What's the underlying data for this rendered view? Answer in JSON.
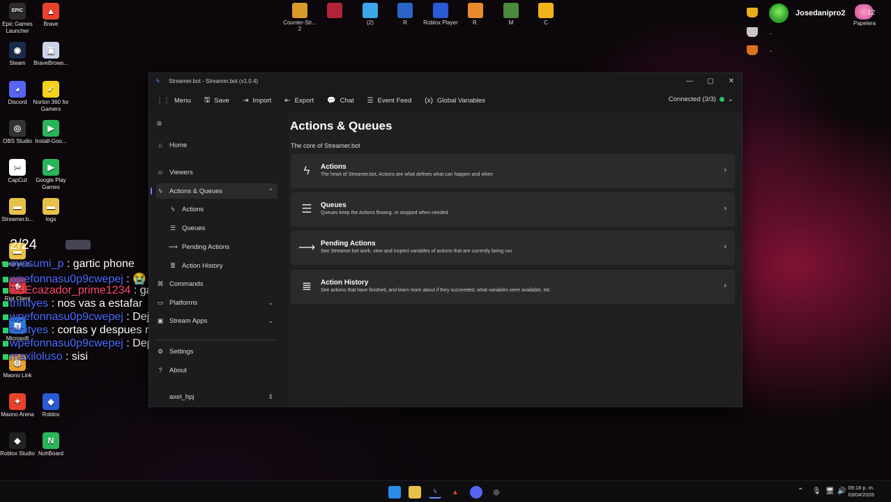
{
  "desktop": {
    "icons": [
      {
        "label": "Epic Games Launcher",
        "color": "#2b2b2b",
        "glyph": "EPIC"
      },
      {
        "label": "Brave",
        "color": "#e8412c",
        "glyph": "▲"
      },
      {
        "label": "Steam",
        "color": "#1a2a4a",
        "glyph": "◉"
      },
      {
        "label": "BraveBrows...",
        "color": "#c9d4e8",
        "glyph": "▣"
      },
      {
        "label": "Discord",
        "color": "#5865f2",
        "glyph": "◕"
      },
      {
        "label": "Norton 360 for Gamers",
        "color": "#f2d21a",
        "glyph": "✓"
      },
      {
        "label": "OBS Studio",
        "color": "#333",
        "glyph": "◎"
      },
      {
        "label": "Install-Goo...",
        "color": "#2ab55a",
        "glyph": "▶"
      },
      {
        "label": "CapCut",
        "color": "#fff",
        "glyph": "✂"
      },
      {
        "label": "Google Play Games",
        "color": "#2ab55a",
        "glyph": "▶"
      },
      {
        "label": "Streamer.b...",
        "color": "#e8c14a",
        "glyph": "▬"
      },
      {
        "label": "logs",
        "color": "#e8c14a",
        "glyph": "▬"
      },
      {
        "label": "Streamer.b...",
        "color": "#e8c14a",
        "glyph": "▬"
      },
      {
        "label": "Riot Client",
        "color": "#d13639",
        "glyph": "◆"
      },
      {
        "label": "Microsoft",
        "color": "#2a7ad6",
        "glyph": "▦"
      },
      {
        "label": "Maono Link",
        "color": "#e8a02c",
        "glyph": "◍"
      },
      {
        "label": "Maono Arena",
        "color": "#e8412c",
        "glyph": "✦"
      },
      {
        "label": "Roblox",
        "color": "#2a5ad6",
        "glyph": "◆"
      },
      {
        "label": "Roblox Studio",
        "color": "#222",
        "glyph": "◆"
      },
      {
        "label": "NohBoard",
        "color": "#2ab55a",
        "glyph": "N"
      }
    ],
    "top_icons": [
      {
        "label": "Counter-Str... 2",
        "color": "#d89a2a"
      },
      {
        "label": "",
        "color": "#b0243a"
      },
      {
        "label": "(2)",
        "color": "#3aa8e8"
      },
      {
        "label": "R",
        "color": "#2a64c8"
      },
      {
        "label": "Roblox Player",
        "color": "#2a5ad6"
      },
      {
        "label": "R.",
        "color": "#e88a2a"
      },
      {
        "label": "M",
        "color": "#4a8a3a"
      },
      {
        "label": "C",
        "color": "#f2b21a"
      }
    ],
    "user": {
      "name": "Josedanipro2",
      "count": "12",
      "bin_label": "Papelera",
      "dash1": "-",
      "dash2": "-"
    }
  },
  "chat": {
    "counter": "2/24",
    "lines": [
      {
        "user": "oyasumi_p",
        "msg": " : gartic phone",
        "red": false
      },
      {
        "user": "wpefonnasu0p9cwepej",
        "msg": " : 😭",
        "red": false
      },
      {
        "user": "THEcazador_prime1234",
        "msg": " : gallet te la pone",
        "red": true
      },
      {
        "user": "trinityes",
        "msg": " : nos vas a estafar",
        "red": false
      },
      {
        "user": "wpefonnasu0p9cwepej",
        "msg": " : Deja eso wue",
        "red": false
      },
      {
        "user": "trinityes",
        "msg": " : cortas y despues no prendes mas",
        "red": false
      },
      {
        "user": "wpefonnasu0p9cwepej",
        "msg": " : Deporsl nunca lo canjean",
        "red": false
      },
      {
        "user": "maxiloluso",
        "msg": " : sisi",
        "red": false
      }
    ]
  },
  "window": {
    "title": "Streamer.bot - Streamer.bot (v1.0.4)",
    "toolbar": [
      {
        "label": "Menu",
        "icon": "⋮⋮"
      },
      {
        "label": "Save",
        "icon": "🖫"
      },
      {
        "label": "Import",
        "icon": "⇥"
      },
      {
        "label": "Export",
        "icon": "⇤"
      },
      {
        "label": "Chat",
        "icon": "💬"
      },
      {
        "label": "Event Feed",
        "icon": "☰"
      },
      {
        "label": "Global Variables",
        "icon": "(x)"
      }
    ],
    "connection": "Connected (3/3)",
    "sidebar": {
      "home": "Home",
      "viewers": "Viewers",
      "actions_queues": "Actions & Queues",
      "actions": "Actions",
      "queues": "Queues",
      "pending_actions": "Pending Actions",
      "action_history": "Action History",
      "commands": "Commands",
      "platforms": "Platforms",
      "stream_apps": "Stream Apps",
      "settings": "Settings",
      "about": "About",
      "profile": "axel_hpj"
    },
    "content": {
      "title": "Actions & Queues",
      "subtitle": "The core of Streamer.bot",
      "cards": [
        {
          "title": "Actions",
          "desc": "The heart of Streamer.bot, Actions are what defines what can happen and when",
          "icon": "ϟ"
        },
        {
          "title": "Queues",
          "desc": "Queues keep the Actions flowing, or stopped when needed",
          "icon": "☰"
        },
        {
          "title": "Pending Actions",
          "desc": "See Streamer.bot work, view and inspect variables of actions that are currently being run",
          "icon": "⟶"
        },
        {
          "title": "Action History",
          "desc": "See actions that have finished, and learn more about if they succeeded, what variables were available, etc",
          "icon": "≣"
        }
      ]
    }
  },
  "taskbar": {
    "time": "09:18 p. m.",
    "date": "03/04/2026"
  }
}
